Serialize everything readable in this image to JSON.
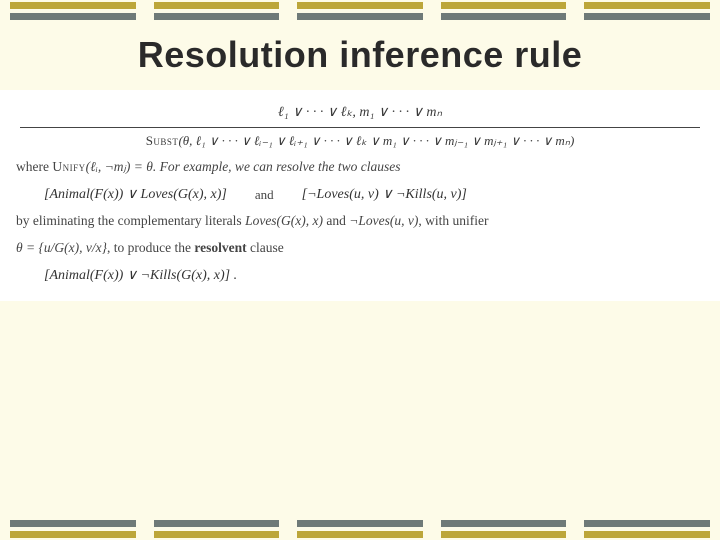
{
  "title": "Resolution inference rule",
  "rule": {
    "premises": "ℓ₁ ∨ · · · ∨ ℓₖ,        m₁ ∨ · · · ∨ mₙ",
    "subst_label": "Subst",
    "conclusion_body": "(θ, ℓ₁ ∨ · · · ∨ ℓᵢ₋₁ ∨ ℓᵢ₊₁ ∨ · · · ∨ ℓₖ ∨ m₁ ∨ · · · ∨ mⱼ₋₁ ∨ mⱼ₊₁ ∨ · · · ∨ mₙ)"
  },
  "where_line": {
    "prefix": "where ",
    "unify_label": "Unify",
    "body": "(ℓᵢ, ¬mⱼ) = θ. For example, we can resolve the two clauses"
  },
  "clauses": {
    "left": "[Animal(F(x)) ∨ Loves(G(x), x)]",
    "and": "and",
    "right": "[¬Loves(u, v) ∨ ¬Kills(u, v)]"
  },
  "elim_line": {
    "prefix": "by eliminating the complementary literals ",
    "lit1": "Loves(G(x), x)",
    "mid": " and ",
    "lit2": "¬Loves(u, v)",
    "suffix": ", with unifier"
  },
  "unifier_line": {
    "theta": "θ = {u/G(x), v/x}",
    "suffix": ", to produce the ",
    "resolvent_word": "resolvent",
    "tail": " clause"
  },
  "resolvent": "[Animal(F(x)) ∨ ¬Kills(G(x), x)] ."
}
